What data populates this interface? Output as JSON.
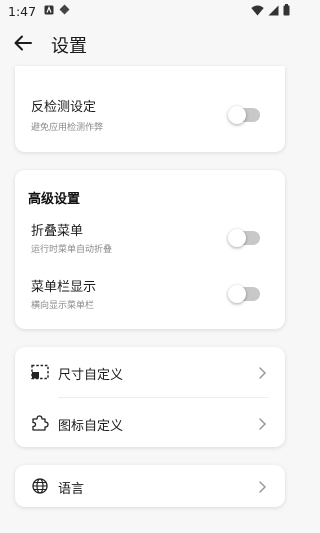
{
  "status": {
    "time": "1:47"
  },
  "header": {
    "title": "设置"
  },
  "anti_detect": {
    "title": "反检测设定",
    "subtitle": "避免应用检测作弊",
    "enabled": false
  },
  "advanced": {
    "section_title": "高级设置",
    "fold_menu": {
      "title": "折叠菜单",
      "subtitle": "运行时菜单自动折叠",
      "enabled": false
    },
    "menubar_display": {
      "title": "菜单栏显示",
      "subtitle": "横向显示菜单栏",
      "enabled": false
    }
  },
  "customize": {
    "size_label": "尺寸自定义",
    "icon_label": "图标自定义"
  },
  "language": {
    "label": "语言"
  },
  "icons": {
    "size": "resize-frame-icon",
    "icon": "puzzle-icon",
    "language": "globe-icon",
    "chevron": "chevron-right-icon",
    "back": "arrow-left-icon"
  }
}
